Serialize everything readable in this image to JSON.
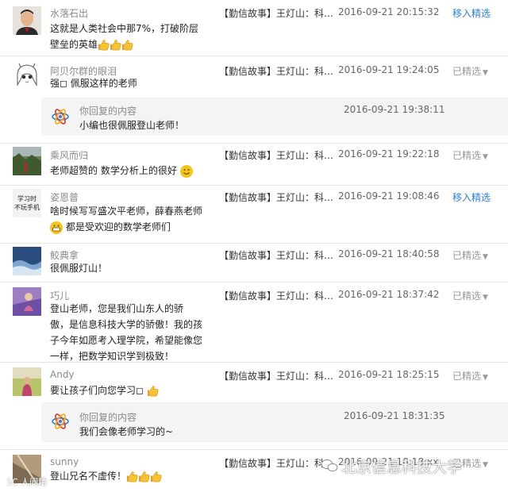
{
  "comments": [
    {
      "nick": "水落石出",
      "content": [
        "这就是人类社会中那7%，打破阶层",
        "壁垒的英雄"
      ],
      "article": "【勤信故事】王灯山：科…",
      "time": "2016-09-21 20:15:32",
      "status": "移入精选"
    },
    {
      "nick": "阿贝尔群的眼泪",
      "content": [
        "强◻ 佩服这样的老师"
      ],
      "article": "【勤信故事】王灯山：科…",
      "time": "2016-09-21 19:24:05",
      "status": "已精选"
    },
    {
      "nick": "乘风而归",
      "content": [
        "老师超赞的 数学分析上的很好"
      ],
      "article": "【勤信故事】王灯山：科…",
      "time": "2016-09-21 19:22:18",
      "status": "已精选"
    },
    {
      "nick": "姿恩普",
      "content": [
        "啥时候写写盛次平老师，薛春燕老师",
        "都是受欢迎的数学老师们"
      ],
      "article": "【勤信故事】王灯山：科…",
      "time": "2016-09-21 19:08:46",
      "status": "移入精选"
    },
    {
      "nick": "鲛典拿",
      "content": [
        "很佩服灯山！"
      ],
      "article": "【勤信故事】王灯山：科…",
      "time": "2016-09-21 18:40:58",
      "status": "已精选"
    },
    {
      "nick": "巧儿",
      "content": [
        "登山老师，您是我们山东人的骄",
        "傲，是信息科技大学的骄傲！我的孩",
        "子今年如愿考入理学院，希望能像您",
        "一样，把数学知识学到极致！"
      ],
      "article": "【勤信故事】王灯山：科…",
      "time": "2016-09-21 18:37:42",
      "status": "已精选"
    },
    {
      "nick": "Andy",
      "content": [
        "要让孩子们向您学习◻"
      ],
      "article": "【勤信故事】王灯山：科…",
      "time": "2016-09-21 18:25:15",
      "status": "已精选"
    },
    {
      "nick": "sunny",
      "content": [
        "登山兄名不虚传！"
      ],
      "article": "【勤信故事】王灯山：科…",
      "time": "2016-09-21 18:18:xx",
      "status": "已精选"
    }
  ],
  "replies": [
    {
      "label": "你回复的内容",
      "text": "小编也很佩服登山老师！",
      "time": "2016-09-21 19:38:11"
    },
    {
      "label": "你回复的内容",
      "text": "我们会像老师学习的~",
      "time": "2016-09-21 18:31:35"
    }
  ],
  "avatar_text": [
    "学习时",
    "不玩手机"
  ],
  "watermark": "北京信息科技大学",
  "watermark_left": "1C 人间精",
  "colors": {
    "link": "#2e7fd1",
    "muted": "#999999",
    "reply_bg": "#f4f4f4"
  }
}
